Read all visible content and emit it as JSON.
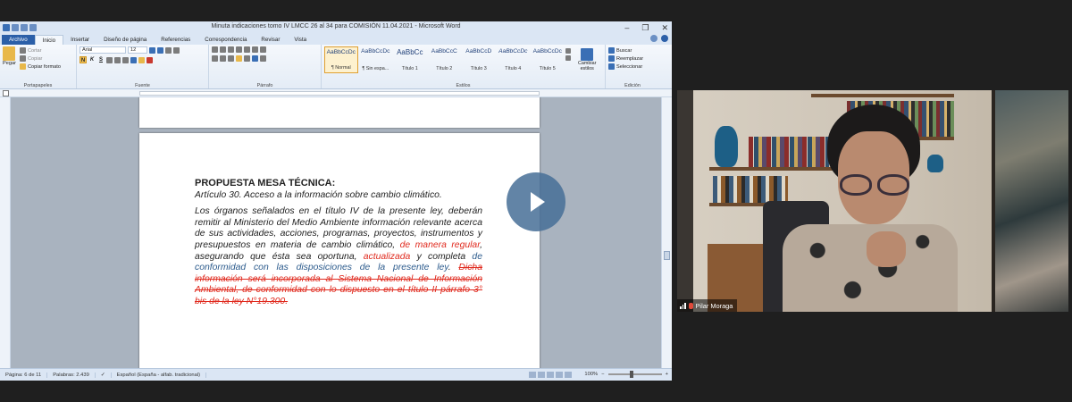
{
  "word": {
    "title": "Minuta indicaciones tomo IV LMCC 26 al 34 para COMISIÓN 11.04.2021  -  Microsoft Word",
    "window_buttons": [
      "–",
      "❐",
      "✕"
    ],
    "tabs": [
      "Archivo",
      "Inicio",
      "Insertar",
      "Diseño de página",
      "Referencias",
      "Correspondencia",
      "Revisar",
      "Vista"
    ],
    "active_tab": "Inicio",
    "ribbon": {
      "clipboard": {
        "paste": "Pegar",
        "cut": "Cortar",
        "copy": "Copiar",
        "format_painter": "Copiar formato",
        "label": "Portapapeles"
      },
      "font": {
        "name": "Arial",
        "size": "12",
        "label": "Fuente"
      },
      "paragraph": {
        "label": "Párrafo"
      },
      "styles": {
        "label": "Estilos",
        "items": [
          {
            "sample": "AaBbCcDc",
            "name": "¶ Normal",
            "active": true
          },
          {
            "sample": "AaBbCcDc",
            "name": "¶ Sin espa..."
          },
          {
            "sample": "AaBbCc",
            "name": "Título 1"
          },
          {
            "sample": "AaBbCcC",
            "name": "Título 2"
          },
          {
            "sample": "AaBbCcD",
            "name": "Título 3"
          },
          {
            "sample": "AaBbCcDc",
            "name": "Título 4"
          },
          {
            "sample": "AaBbCcDc",
            "name": "Título 5"
          }
        ],
        "change_styles": "Cambiar estilos"
      },
      "editing": {
        "find": "Buscar",
        "replace": "Reemplazar",
        "select": "Seleccionar",
        "label": "Edición"
      }
    },
    "document": {
      "heading": "PROPUESTA MESA TÉCNICA:",
      "article": "Artículo 30.  Acceso a la información sobre cambio climático.",
      "body_plain_1": "Los órganos señalados en el título IV de la presente ley, deberán remitir al Ministerio del Medio Ambiente información relevante acerca de sus actividades, acciones, programas, proyectos, instrumentos y presupuestos en materia de cambio climático, ",
      "ins_1": "de manera regular",
      "body_plain_2": ", asegurando que ésta sea oportuna, ",
      "ins_2": "actualizada",
      "body_plain_3": " y completa ",
      "ins_3": "de conformidad con las disposiciones de la presente ley",
      "body_plain_4": ". ",
      "deleted": "Dicha información será incorporada al Sistema Nacional de Información Ambiental, de conformidad con lo dispuesto en el título II párrafo 3° bis de la ley N°19.300."
    },
    "status": {
      "page": "Página: 6 de 11",
      "words": "Palabras: 2.439",
      "language": "Español (España - alfab. tradicional)",
      "zoom": "100%"
    }
  },
  "video": {
    "participant_name": "Pilar Moraga"
  },
  "colors": {
    "insert_red": "#e02a1e",
    "insert_blue": "#2b5a8c",
    "play_button": "#466e96",
    "word_file_tab": "#2b5fa8"
  }
}
